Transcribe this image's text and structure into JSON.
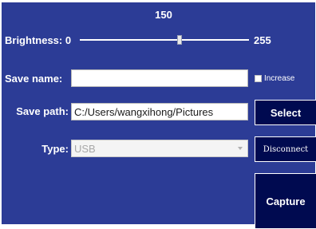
{
  "slider": {
    "label": "Brightness:",
    "min_label": "0",
    "max_label": "255",
    "value_label": "150",
    "value": 150,
    "min": 0,
    "max": 255
  },
  "save_name": {
    "label": "Save name:",
    "value": "",
    "checkbox_label": "Increase",
    "checkbox_checked": false
  },
  "save_path": {
    "label": "Save path:",
    "value": "C:/Users/wangxihong/Pictures",
    "button_label": "Select"
  },
  "type": {
    "label": "Type:",
    "selected": "USB",
    "button_label": "Disconnect"
  },
  "capture": {
    "button_label": "Capture"
  },
  "colors": {
    "panel_background": "#2c3c96",
    "button_background": "#000a50"
  }
}
